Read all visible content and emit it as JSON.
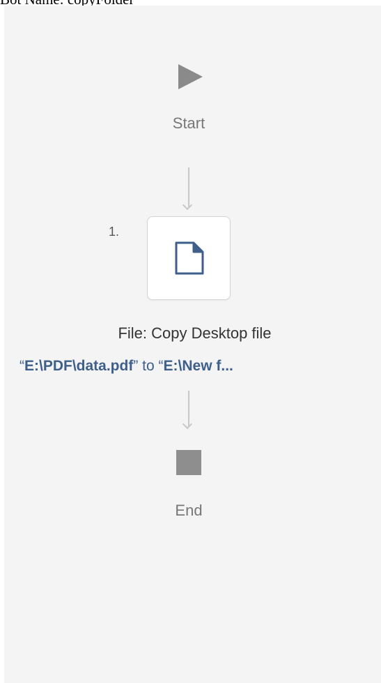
{
  "header": {
    "bot_name": "Bot Name: copyFolder"
  },
  "flow": {
    "start_label": "Start",
    "end_label": "End",
    "steps": [
      {
        "number": "1.",
        "icon": "file-icon",
        "title": "File: Copy Desktop file",
        "desc_quote_open": "“",
        "source": "E:\\PDF\\data.pdf",
        "desc_quote_close": "”",
        "connector_word": " to ",
        "dest_quote_open": "“",
        "destination": "E:\\New f..."
      }
    ]
  },
  "colors": {
    "canvas": "#f4f4f4",
    "link_blue": "#3d5f8a",
    "icon_gray": "#8a8a8a"
  }
}
